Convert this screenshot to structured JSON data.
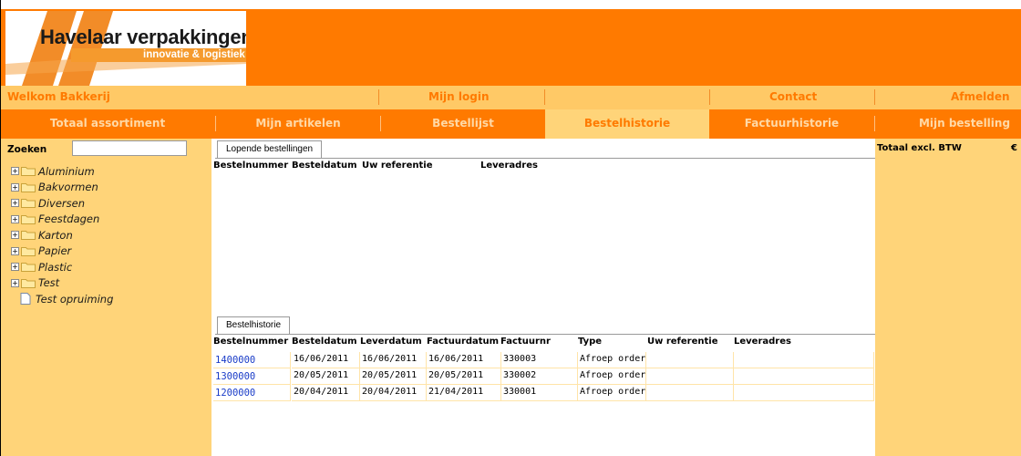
{
  "logo": {
    "brand": "Havelaar verpakkingen",
    "tagline": "innovatie & logistiek"
  },
  "topnav": {
    "welcome": "Welkom Bakkerij",
    "login": "Mijn login",
    "contact": "Contact",
    "logout": "Afmelden"
  },
  "mainnav": {
    "tabs": [
      "Totaal assortiment",
      "Mijn artikelen",
      "Bestellijst",
      "Bestelhistorie",
      "Factuurhistorie",
      "Mijn bestelling"
    ],
    "active": "Bestelhistorie"
  },
  "sidebar": {
    "search_label": "Zoeken",
    "search_value": "",
    "tree": [
      {
        "label": "Aluminium",
        "type": "folder"
      },
      {
        "label": "Bakvormen",
        "type": "folder"
      },
      {
        "label": "Diversen",
        "type": "folder"
      },
      {
        "label": "Feestdagen",
        "type": "folder"
      },
      {
        "label": "Karton",
        "type": "folder"
      },
      {
        "label": "Papier",
        "type": "folder"
      },
      {
        "label": "Plastic",
        "type": "folder"
      },
      {
        "label": "Test",
        "type": "folder"
      },
      {
        "label": "Test opruiming",
        "type": "file"
      }
    ]
  },
  "rightbar": {
    "total_label": "Totaal excl. BTW",
    "currency": "€"
  },
  "current_orders": {
    "tab": "Lopende bestellingen",
    "columns": [
      "Bestelnummer",
      "Besteldatum",
      "Uw referentie",
      "Leveradres"
    ],
    "rows": []
  },
  "history": {
    "tab": "Bestelhistorie",
    "columns": [
      "Bestelnummer",
      "Besteldatum",
      "Leverdatum",
      "Factuurdatum",
      "Factuurnr",
      "Type",
      "Uw referentie",
      "Leveradres"
    ],
    "rows": [
      {
        "order": "1400000",
        "ordered": "16/06/2011",
        "delivered": "16/06/2011",
        "invoiced": "16/06/2011",
        "invoice": "330003",
        "type": "Afroep order",
        "ref": "",
        "address": ""
      },
      {
        "order": "1300000",
        "ordered": "20/05/2011",
        "delivered": "20/05/2011",
        "invoiced": "20/05/2011",
        "invoice": "330002",
        "type": "Afroep order",
        "ref": "",
        "address": ""
      },
      {
        "order": "1200000",
        "ordered": "20/04/2011",
        "delivered": "20/04/2011",
        "invoiced": "21/04/2011",
        "invoice": "330001",
        "type": "Afroep order",
        "ref": "",
        "address": ""
      }
    ]
  },
  "colors": {
    "orange": "#ff7a00",
    "light_orange": "#ffd479",
    "link_blue": "#1a3cc8"
  }
}
